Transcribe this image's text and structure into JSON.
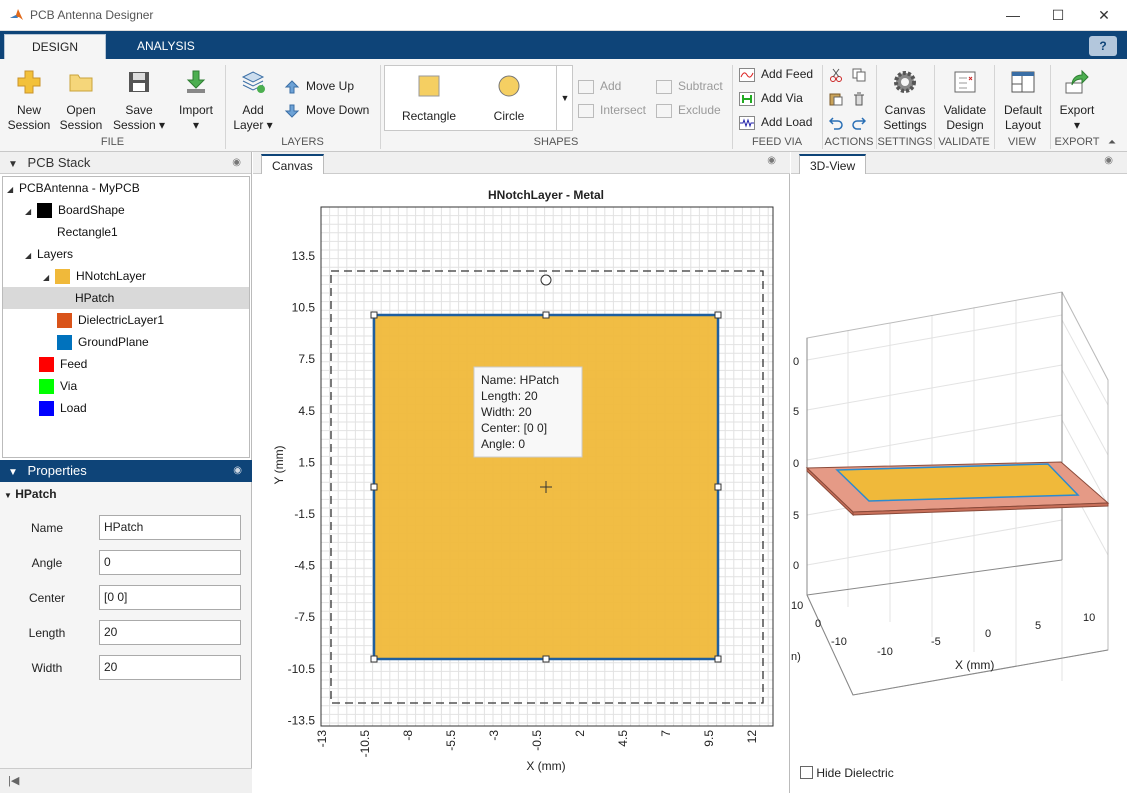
{
  "window": {
    "title": "PCB Antenna Designer",
    "min": "—",
    "max": "☐",
    "close": "✕"
  },
  "tabs": [
    {
      "label": "DESIGN"
    },
    {
      "label": "ANALYSIS"
    }
  ],
  "help_label": "?",
  "ribbon": {
    "file": {
      "new_session": [
        "New",
        "Session"
      ],
      "open_session": [
        "Open",
        "Session"
      ],
      "save_session": [
        "Save",
        "Session ▾"
      ],
      "import": [
        "Import",
        "▾"
      ],
      "section": "FILE"
    },
    "layers": {
      "add_layer": [
        "Add",
        "Layer ▾"
      ],
      "move_up": "Move Up",
      "move_down": "Move Down",
      "section": "LAYERS"
    },
    "shapes": {
      "rectangle": "Rectangle",
      "circle": "Circle",
      "add": "Add",
      "intersect": "Intersect",
      "subtract": "Subtract",
      "exclude": "Exclude",
      "section": "SHAPES"
    },
    "feed_via": {
      "add_feed": "Add Feed",
      "add_via": "Add Via",
      "add_load": "Add Load",
      "section": "FEED VIA"
    },
    "actions": {
      "section": "ACTIONS"
    },
    "settings": {
      "canvas_settings": [
        "Canvas",
        "Settings"
      ],
      "section": "SETTINGS"
    },
    "validate": {
      "validate_design": [
        "Validate",
        "Design"
      ],
      "section": "VALIDATE"
    },
    "view": {
      "default_layout": [
        "Default",
        "Layout"
      ],
      "section": "VIEW"
    },
    "export": {
      "export": [
        "Export",
        "▾"
      ],
      "section": "EXPORT"
    }
  },
  "pcb_stack": {
    "title": "PCB Stack",
    "items": [
      {
        "label": "PCBAntenna - MyPCB",
        "expanded": true
      },
      {
        "label": "BoardShape",
        "color": "#000000",
        "expanded": true
      },
      {
        "label": "Rectangle1"
      },
      {
        "label": "Layers",
        "expanded": true
      },
      {
        "label": "HNotchLayer",
        "color": "#f0b93a",
        "expanded": true
      },
      {
        "label": "HPatch",
        "selected": true
      },
      {
        "label": "DielectricLayer1",
        "color": "#d95319"
      },
      {
        "label": "GroundPlane",
        "color": "#0072bd"
      },
      {
        "label": "Feed",
        "color": "#ff0000"
      },
      {
        "label": "Via",
        "color": "#00ff00"
      },
      {
        "label": "Load",
        "color": "#0000ff"
      }
    ]
  },
  "properties": {
    "title": "Properties",
    "object": "HPatch",
    "fields": [
      {
        "label": "Name",
        "value": "HPatch"
      },
      {
        "label": "Angle",
        "value": "0"
      },
      {
        "label": "Center",
        "value": "[0 0]"
      },
      {
        "label": "Length",
        "value": "20"
      },
      {
        "label": "Width",
        "value": "20"
      }
    ]
  },
  "canvas": {
    "tab_label": "Canvas",
    "plot_title": "HNotchLayer - Metal",
    "xlabel": "X (mm)",
    "ylabel": "Y (mm)",
    "yticks": [
      "13.5",
      "10.5",
      "7.5",
      "4.5",
      "1.5",
      "-1.5",
      "-4.5",
      "-7.5",
      "-10.5",
      "-13.5"
    ],
    "xticks": [
      "-13",
      "-10.5",
      "-8",
      "-5.5",
      "-3",
      "-0.5",
      "2",
      "4.5",
      "7",
      "9.5",
      "12"
    ],
    "shape": {
      "color": "#f0b93a",
      "edge": "#1f5f9f"
    },
    "tooltip": [
      "Name: HPatch",
      "Length: 20",
      "Width: 20",
      "Center: [0  0]",
      "Angle: 0"
    ]
  },
  "view3d": {
    "tab_label": "3D-View",
    "xlabel": "X (mm)",
    "ylabel_fragment": "n)",
    "xticks": [
      "-10",
      "-5",
      "0",
      "5",
      "10"
    ],
    "yticks": [
      "10",
      "0",
      "-10"
    ],
    "zticks": [
      "0",
      "5",
      "0",
      "5",
      "0"
    ],
    "hide_dielectric_label": "Hide Dielectric",
    "hide_dielectric_checked": false
  }
}
